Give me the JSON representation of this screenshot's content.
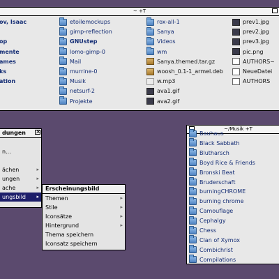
{
  "top_window": {
    "title": "~ +T",
    "col0": [
      "ov, Isaac",
      "",
      "op",
      "mente",
      "ames",
      "ks",
      "ation"
    ],
    "col1": [
      {
        "label": "etoilemockups",
        "icon": "folder"
      },
      {
        "label": "gimp-reflection",
        "icon": "folder"
      },
      {
        "label": "GNUstep",
        "icon": "folder",
        "bold": true
      },
      {
        "label": "lomo-gimp-0",
        "icon": "folder"
      },
      {
        "label": "Mail",
        "icon": "folder"
      },
      {
        "label": "murrine-0",
        "icon": "folder"
      },
      {
        "label": "Musik",
        "icon": "folder"
      },
      {
        "label": "netsurf-2",
        "icon": "folder"
      },
      {
        "label": "Projekte",
        "icon": "folder"
      }
    ],
    "col2": [
      {
        "label": "rox-all-1",
        "icon": "folder"
      },
      {
        "label": "Sanya",
        "icon": "folder"
      },
      {
        "label": "Videos",
        "icon": "folder"
      },
      {
        "label": "wm",
        "icon": "folder"
      },
      {
        "label": "Sanya.themed.tar.gz",
        "icon": "archive"
      },
      {
        "label": "woosh_0.1-1_armel.deb",
        "icon": "archive"
      },
      {
        "label": "w.mp3",
        "icon": "sound"
      },
      {
        "label": "ava1.gif",
        "icon": "image"
      },
      {
        "label": "ava2.gif",
        "icon": "image"
      }
    ],
    "col3": [
      {
        "label": "prev1.jpg",
        "icon": "image"
      },
      {
        "label": "prev2.jpg",
        "icon": "image"
      },
      {
        "label": "prev3.jpg",
        "icon": "image"
      },
      {
        "label": "pic.png",
        "icon": "image"
      },
      {
        "label": "AUTHORS~",
        "icon": "doc"
      },
      {
        "label": "NeueDatei",
        "icon": "doc"
      },
      {
        "label": "AUTHORS",
        "icon": "doc"
      }
    ]
  },
  "settings_menu": {
    "title": "dungen",
    "close": "✕",
    "items": [
      {
        "label": "",
        "arrow": ""
      },
      {
        "label": "n...",
        "arrow": ""
      },
      {
        "label": "",
        "arrow": ""
      },
      {
        "label": "ächen",
        "arrow": "▸"
      },
      {
        "label": "ungen",
        "arrow": "▸"
      },
      {
        "label": "ache",
        "arrow": "▸"
      },
      {
        "label": "ungsbild",
        "arrow": "▸",
        "selected": true
      }
    ]
  },
  "appearance_menu": {
    "title": "Erscheinungsbild",
    "items": [
      {
        "label": "Themen",
        "arrow": "▸"
      },
      {
        "label": "Stile",
        "arrow": "▸"
      },
      {
        "label": "Iconsätze",
        "arrow": "▸"
      },
      {
        "label": "Hintergrund",
        "arrow": "▸"
      },
      {
        "label": "Thema speichern",
        "arrow": ""
      },
      {
        "label": "Iconsatz speichern",
        "arrow": ""
      }
    ]
  },
  "music_window": {
    "title": "~/Musik +T",
    "items": [
      "Bauhaus",
      "Black Sabbath",
      "Blutharsch",
      "Boyd Rice & Friends",
      "Bronski Beat",
      "Bruderschaft",
      "burningCHROME",
      "burning chrome",
      "Camouflage",
      "Cephalgy",
      "Chess",
      "Clan of Xymox",
      "Combichrist",
      "Compilations"
    ]
  }
}
